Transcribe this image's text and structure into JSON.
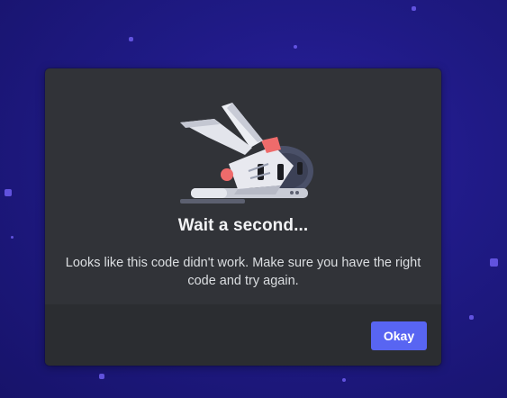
{
  "dialog": {
    "title": "Wait a second...",
    "message": "Looks like this code didn't work. Make sure you have the right code and try again.",
    "okay_label": "Okay",
    "illustration_icon": "crashed-spaceship-icon"
  },
  "colors": {
    "background": "#1f1a85",
    "modal_body": "#313338",
    "modal_footer": "#2b2d31",
    "button_accent": "#5865f2",
    "title_text": "#f2f3f5",
    "body_text": "#dbdee1"
  }
}
